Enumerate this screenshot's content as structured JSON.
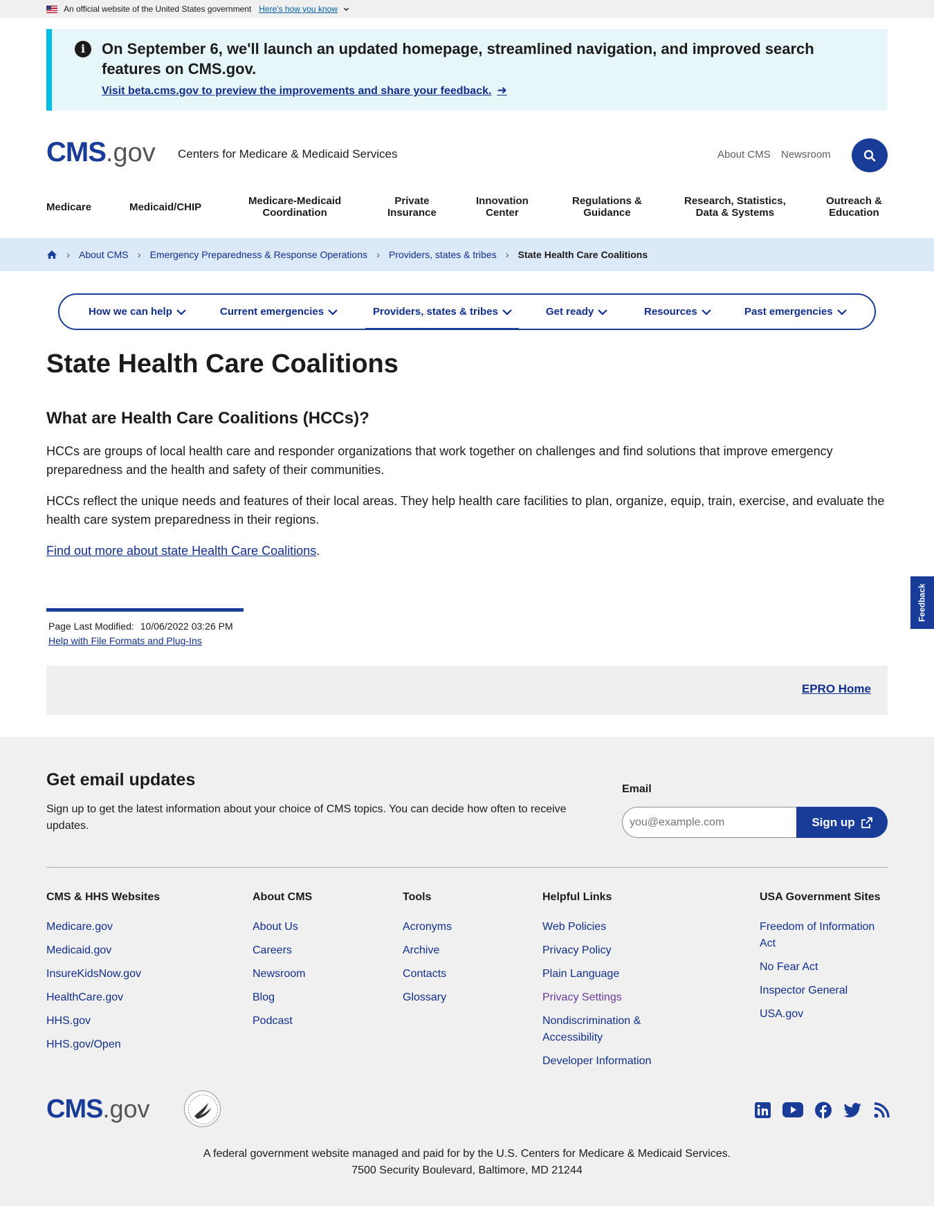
{
  "gov_banner": {
    "text": "An official website of the United States government",
    "how_link": "Here's how you know"
  },
  "alert": {
    "heading": "On September 6, we'll launch an updated homepage, streamlined navigation, and improved search features on CMS.gov.",
    "link": "Visit beta.cms.gov to preview the improvements and share your feedback."
  },
  "header": {
    "logo_cms": "CMS",
    "logo_gov": ".gov",
    "site_name": "Centers for Medicare & Medicaid Services",
    "utility_links": [
      "About CMS",
      "Newsroom"
    ],
    "search_label": "Search"
  },
  "main_nav": [
    {
      "line1": "Medicare",
      "line2": ""
    },
    {
      "line1": "Medicaid/CHIP",
      "line2": ""
    },
    {
      "line1": "Medicare-Medicaid",
      "line2": "Coordination"
    },
    {
      "line1": "Private",
      "line2": "Insurance"
    },
    {
      "line1": "Innovation",
      "line2": "Center"
    },
    {
      "line1": "Regulations &",
      "line2": "Guidance"
    },
    {
      "line1": "Research, Statistics,",
      "line2": "Data & Systems"
    },
    {
      "line1": "Outreach &",
      "line2": "Education"
    }
  ],
  "breadcrumb": {
    "items": [
      "About CMS",
      "Emergency Preparedness & Response Operations",
      "Providers, states & tribes"
    ],
    "current": "State Health Care Coalitions"
  },
  "subnav": [
    "How we can help",
    "Current emergencies",
    "Providers, states & tribes",
    "Get ready",
    "Resources",
    "Past emergencies"
  ],
  "content": {
    "title": "State Health Care Coalitions",
    "h2": "What are Health Care Coalitions (HCCs)?",
    "p1": "HCCs are groups of local health care and responder organizations that work together on challenges and find solutions that improve emergency preparedness and the health and safety of their communities.",
    "p2": "HCCs reflect the unique needs and features of their local areas. They help health care facilities to plan, organize, equip, train, exercise, and evaluate the health care system preparedness in their regions.",
    "p3_link": "Find out more about state Health Care Coalitions",
    "p3_suffix": "."
  },
  "feedback": "Feedback",
  "meta": {
    "modified_label": "Page Last Modified:",
    "modified_value": "10/06/2022 03:26 PM",
    "help_link": "Help with File Formats and Plug-Ins"
  },
  "epro_link": "EPRO Home",
  "footer": {
    "email_heading": "Get email updates",
    "email_desc": "Sign up to get the latest information about your choice of CMS topics. You can decide how often to receive updates.",
    "email_label": "Email",
    "email_placeholder": "you@example.com",
    "signup_label": "Sign up",
    "columns": [
      {
        "title": "CMS & HHS Websites",
        "links": [
          "Medicare.gov",
          "Medicaid.gov",
          "InsureKidsNow.gov",
          "HealthCare.gov",
          "HHS.gov",
          "HHS.gov/Open"
        ]
      },
      {
        "title": "About CMS",
        "links": [
          "About Us",
          "Careers",
          "Newsroom",
          "Blog",
          "Podcast"
        ]
      },
      {
        "title": "Tools",
        "links": [
          "Acronyms",
          "Archive",
          "Contacts",
          "Glossary"
        ]
      },
      {
        "title": "Helpful Links",
        "links": [
          "Web Policies",
          "Privacy Policy",
          "Plain Language",
          "Privacy Settings",
          "Nondiscrimination & Accessibility",
          "Developer Information"
        ]
      },
      {
        "title": "USA Government Sites",
        "links": [
          "Freedom of Information Act",
          "No Fear Act",
          "Inspector General",
          "USA.gov"
        ]
      }
    ],
    "social_icons": [
      "linkedin-icon",
      "youtube-icon",
      "facebook-icon",
      "twitter-icon",
      "rss-icon"
    ],
    "legal_line1": "A federal government website managed and paid for by the U.S. Centers for Medicare & Medicaid Services.",
    "legal_line2": "7500 Security Boulevard, Baltimore, MD 21244"
  },
  "colors": {
    "primary": "#1a3c99",
    "link": "#112e8c",
    "alert_bg": "#e7f6f8",
    "alert_border": "#00bde3",
    "breadcrumb_bg": "#dce9f9",
    "footer_bg": "#f0f0f0",
    "visited_link": "#6b3a9b"
  }
}
